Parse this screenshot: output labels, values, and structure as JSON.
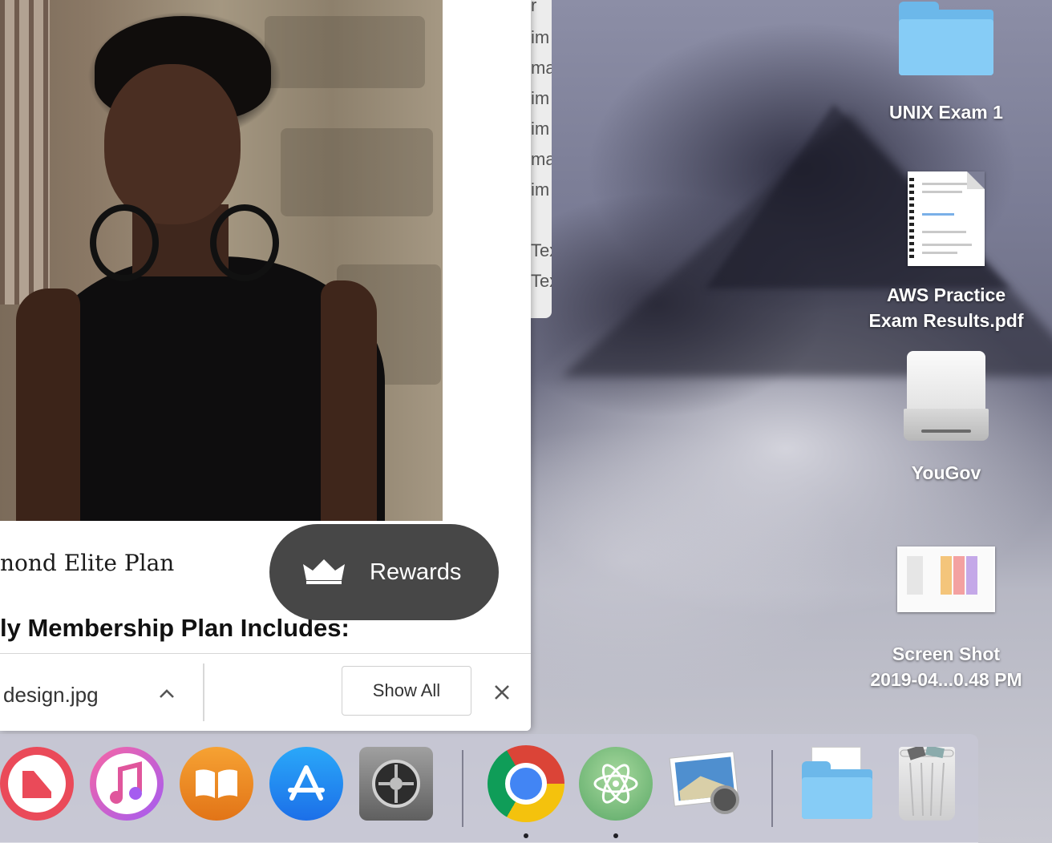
{
  "browser": {
    "plan_text": "nond Elite Plan",
    "membership_heading": "ly Membership Plan Includes:",
    "rewards_button": "Rewards"
  },
  "download_bar": {
    "file_name": "design.jpg",
    "show_all_label": "Show All"
  },
  "background_window": {
    "rows": [
      "r",
      "im",
      "ma",
      "im",
      "im",
      "ma",
      "im",
      "Tex",
      "Tex"
    ]
  },
  "desktop": {
    "icons": [
      {
        "label": "UNIX Exam 1",
        "icon": "folder-icon"
      },
      {
        "label_line1": "AWS Practice",
        "label_line2": "Exam Results.pdf",
        "icon": "pdf-document-icon"
      },
      {
        "label": "YouGov",
        "icon": "external-drive-icon"
      },
      {
        "label_line1": "Screen Shot",
        "label_line2": "2019-04...0.48 PM",
        "icon": "screenshot-thumbnail-icon"
      }
    ]
  },
  "dock": {
    "apps": [
      {
        "name": "News",
        "icon": "news-app-icon"
      },
      {
        "name": "iTunes",
        "icon": "itunes-app-icon"
      },
      {
        "name": "Books",
        "icon": "books-app-icon"
      },
      {
        "name": "App Store",
        "icon": "app-store-icon"
      },
      {
        "name": "System Preferences",
        "icon": "system-preferences-icon"
      },
      {
        "name": "Google Chrome",
        "icon": "chrome-app-icon",
        "running": true
      },
      {
        "name": "Atom",
        "icon": "atom-app-icon",
        "running": true
      },
      {
        "name": "Preview",
        "icon": "preview-app-icon"
      },
      {
        "name": "Downloads",
        "icon": "downloads-folder-icon"
      },
      {
        "name": "Trash",
        "icon": "trash-icon"
      }
    ]
  },
  "colors": {
    "rewards_bg": "#474747",
    "folder_blue": "#86ccf6",
    "dock_bg": "#c8c8d7"
  }
}
